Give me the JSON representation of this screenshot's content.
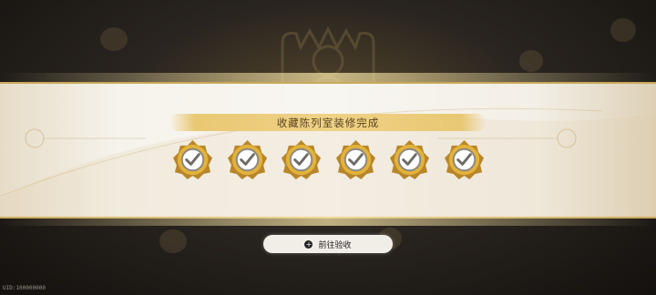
{
  "banner": {
    "title": "收藏陈列室装修完成",
    "badges": [
      {
        "icon": "check-badge-icon",
        "state": "completed"
      },
      {
        "icon": "check-badge-icon",
        "state": "completed"
      },
      {
        "icon": "check-badge-icon",
        "state": "completed"
      },
      {
        "icon": "check-badge-icon",
        "state": "completed"
      },
      {
        "icon": "check-badge-icon",
        "state": "completed"
      },
      {
        "icon": "check-badge-icon",
        "state": "completed"
      }
    ]
  },
  "action_button": {
    "label": "前往验收",
    "icon": "plus-circle-icon"
  },
  "footer": {
    "uid_text": "UID:100000000"
  },
  "colors": {
    "gold": "#e3b23a",
    "gold_dark": "#b8862a",
    "banner_bg": "#f6f3ec",
    "title_bar": "#efd286"
  }
}
